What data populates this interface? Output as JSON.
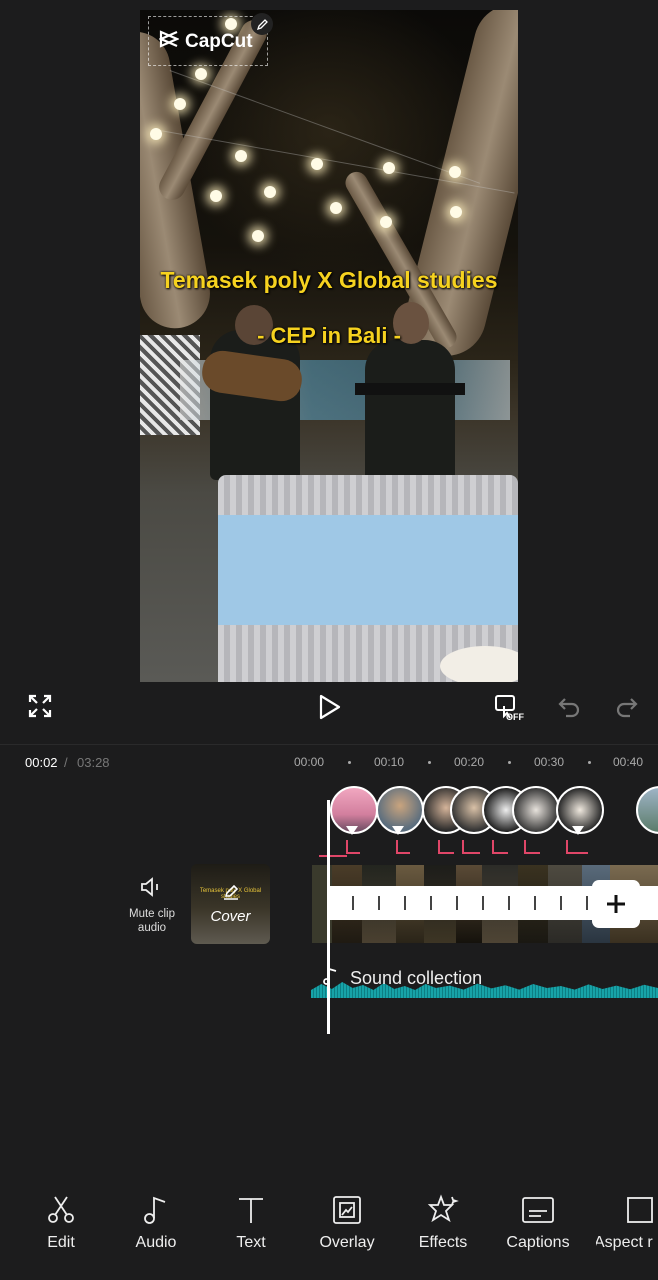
{
  "preview": {
    "logo_text": "CapCut",
    "title_line1": "Temasek poly X Global studies",
    "title_line2": "- CEP in Bali -"
  },
  "player": {
    "fullscreen_icon": "expand-icon",
    "play_icon": "play-icon",
    "keyframe_icon": "keyframe-off-icon",
    "keyframe_label": "OFF",
    "undo_icon": "undo-icon",
    "redo_icon": "redo-icon"
  },
  "timeline": {
    "current_time": "00:02",
    "separator": "/",
    "total_time": "03:28",
    "ruler": [
      "00:00",
      "00:10",
      "00:20",
      "00:30",
      "00:40"
    ],
    "mute_label": "Mute clip audio",
    "cover_label": "Cover",
    "cover_caption": "Temasek poly X Global studies",
    "sound_label": "Sound collection"
  },
  "toolbar": {
    "items": [
      {
        "label": "Edit",
        "icon": "scissors-icon"
      },
      {
        "label": "Audio",
        "icon": "music-note-icon"
      },
      {
        "label": "Text",
        "icon": "text-icon"
      },
      {
        "label": "Overlay",
        "icon": "overlay-icon"
      },
      {
        "label": "Effects",
        "icon": "effects-star-icon"
      },
      {
        "label": "Captions",
        "icon": "captions-icon"
      },
      {
        "label": "Aspect r",
        "icon": "aspect-ratio-icon"
      }
    ]
  },
  "colors": {
    "background": "#1c1c1d",
    "title_yellow": "#f6d21f",
    "marker_pink": "#e04668",
    "wave_teal": "#17a3a8"
  }
}
